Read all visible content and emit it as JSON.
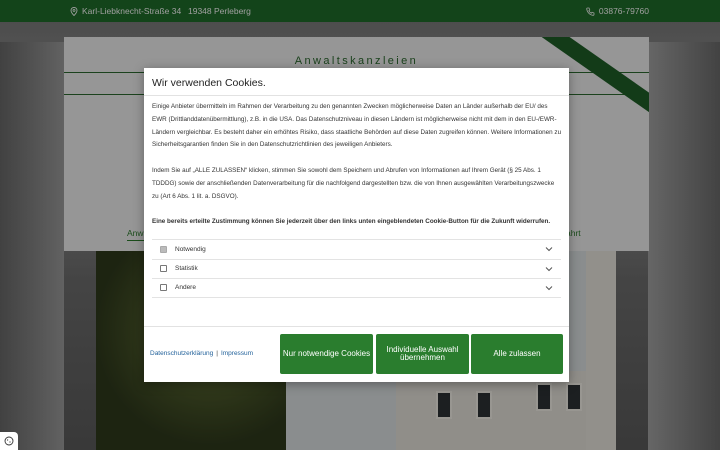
{
  "topbar": {
    "address": "Karl-Liebknecht-Straße 34",
    "city": "19348 Perleberg",
    "phone": "03876-79760"
  },
  "header": {
    "title": "Anwaltskanzleien",
    "nav_left": "Anw",
    "nav_right": "ahrt"
  },
  "cookie_modal": {
    "title": "Wir verwenden Cookies.",
    "paragraphs": [
      "Einige Anbieter übermitteln im Rahmen der Verarbeitung zu den genannten Zwecken möglicherweise Daten an Länder außerhalb der EU/ des EWR (Drittlanddatenübermittlung), z.B. in die USA. Das Datenschutzniveau in diesen Ländern ist möglicherweise nicht mit dem in den EU-/EWR-Ländern vergleichbar. Es besteht daher ein erhöhtes Risiko, dass staatliche Behörden auf diese Daten zugreifen können. Weitere Informationen zu Sicherheitsgarantien finden Sie in den Datenschutzrichtlinien des jeweiligen Anbieters.",
      "Indem Sie auf „ALLE ZULASSEN“ klicken, stimmen Sie sowohl dem Speichern und Abrufen von Informationen auf Ihrem Gerät (§ 25 Abs. 1 TDDDG) sowie der anschließenden Datenverarbeitung für die nachfolgend dargestellten bzw. die von Ihnen ausgewählten Verarbeitungszwecke zu (Art 6 Abs. 1 lit. a. DSGVO).",
      "Eine bereits erteilte Zustimmung können Sie jederzeit über den links unten eingeblendeten Cookie-Button für die Zukunft widerrufen."
    ],
    "options": [
      {
        "label": "Notwendig",
        "checked": true,
        "disabled": true
      },
      {
        "label": "Statistik",
        "checked": false,
        "disabled": false
      },
      {
        "label": "Andere",
        "checked": false,
        "disabled": false
      }
    ],
    "links": {
      "privacy": "Datenschutzerklärung",
      "separator": "|",
      "imprint": "Impressum"
    },
    "buttons": {
      "necessary": "Nur notwendige Cookies",
      "individual": "Individuelle Auswahl übernehmen",
      "accept_all": "Alle zulassen"
    }
  },
  "colors": {
    "brand_green": "#1f6f2a",
    "button_green": "#2a7d2e",
    "link_blue": "#1f5f99"
  }
}
